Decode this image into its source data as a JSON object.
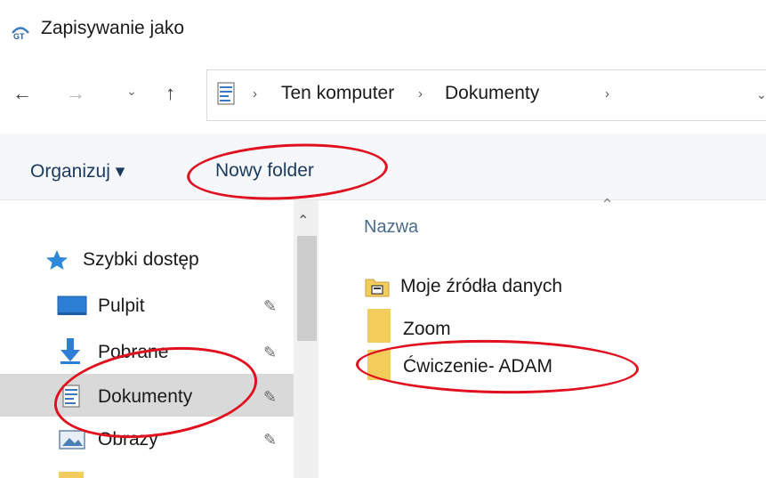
{
  "window": {
    "title": "Zapisywanie jako"
  },
  "nav": {
    "back_icon": "←",
    "forward_icon": "→",
    "recent_icon": "⌄",
    "up_icon": "↑",
    "separator": "›",
    "crumbs": [
      "Ten komputer",
      "Dokumenty"
    ],
    "dropdown_icon": "⌄"
  },
  "toolbar": {
    "organize_label": "Organizuj ▾",
    "new_folder_label": "Nowy folder"
  },
  "sidebar": {
    "items": [
      {
        "label": "Szybki dostęp",
        "pinned": false,
        "selected": false
      },
      {
        "label": "Pulpit",
        "pinned": true,
        "selected": false
      },
      {
        "label": "Pobrane",
        "pinned": true,
        "selected": false
      },
      {
        "label": "Dokumenty",
        "pinned": true,
        "selected": true
      },
      {
        "label": "Obrazy",
        "pinned": true,
        "selected": false
      }
    ],
    "pin_icon": "📌",
    "scroll_up_icon": "⌃"
  },
  "files": {
    "column_name": "Nazwa",
    "sort_icon": "⌃",
    "items": [
      {
        "name": "Moje źródła danych",
        "kind": "special-folder"
      },
      {
        "name": "Zoom",
        "kind": "folder"
      },
      {
        "name": "Ćwiczenie- ADAM",
        "kind": "folder"
      }
    ]
  },
  "colors": {
    "annotation": "#e0101e",
    "folder": "#f3cd5c",
    "star": "#2f88d8",
    "selection": "#d9d9d9"
  }
}
